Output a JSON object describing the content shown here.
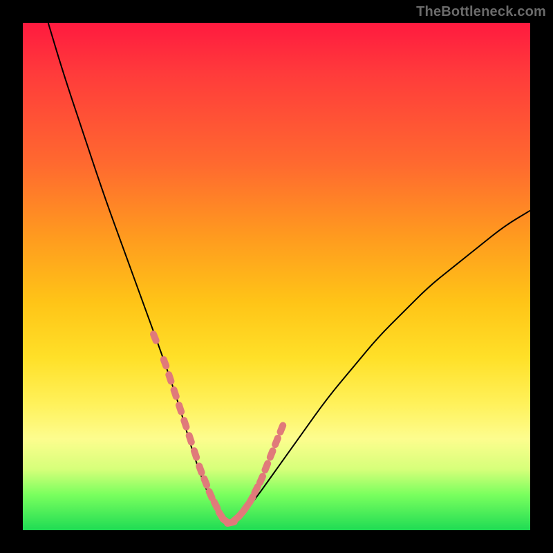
{
  "watermark": "TheBottleneck.com",
  "chart_data": {
    "type": "line",
    "title": "",
    "xlabel": "",
    "ylabel": "",
    "xlim": [
      0,
      100
    ],
    "ylim": [
      0,
      100
    ],
    "grid": false,
    "series": [
      {
        "name": "bottleneck-curve",
        "color": "#000000",
        "x": [
          5,
          8,
          12,
          16,
          20,
          24,
          28,
          31,
          33,
          35,
          37,
          39,
          40,
          42,
          45,
          50,
          55,
          60,
          65,
          70,
          75,
          80,
          85,
          90,
          95,
          100
        ],
        "y": [
          100,
          90,
          78,
          66,
          55,
          44,
          33,
          24,
          17,
          11,
          6,
          3,
          1.5,
          2,
          5,
          12,
          19,
          26,
          32,
          38,
          43,
          48,
          52,
          56,
          60,
          63
        ]
      },
      {
        "name": "curve-markers",
        "color": "#e07a7a",
        "type": "scatter",
        "x": [
          26,
          28,
          29,
          30,
          31,
          32,
          33,
          34,
          35,
          36,
          37,
          38,
          39,
          40,
          41,
          42,
          43,
          44,
          45,
          46,
          47,
          48,
          49,
          50,
          51
        ],
        "y": [
          38,
          33,
          30,
          27,
          24,
          21,
          18,
          15,
          12,
          9.5,
          7,
          5,
          3,
          1.8,
          1.5,
          2.2,
          3.2,
          4.5,
          6,
          8,
          10,
          12.5,
          15,
          17.5,
          20
        ]
      }
    ]
  }
}
